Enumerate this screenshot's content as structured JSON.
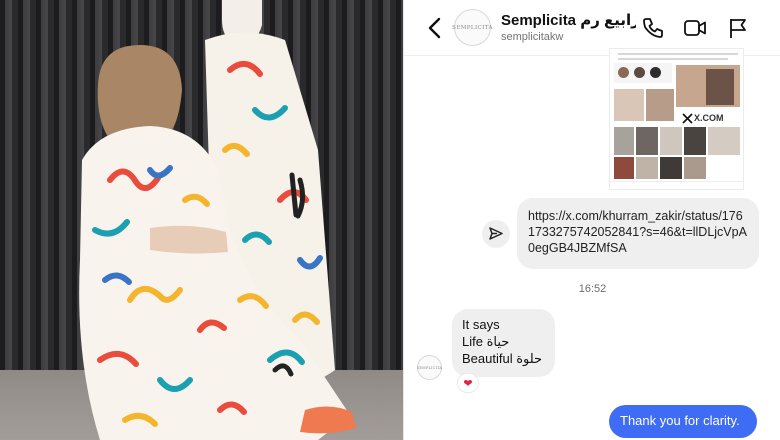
{
  "header": {
    "name": "Semplicita درابيع رم...",
    "handle": "semplicitakw",
    "avatar_text": "SEMPLICITA"
  },
  "shared_post": {
    "site_label": "X.COM"
  },
  "messages": {
    "link_text": "https://x.com/khurram_zakir/status/1761733275742052841?s=46&t=llDLjcVpA0egGB4JBZMfSA",
    "timestamp": "16:52",
    "received_lines": {
      "l1": "It says",
      "l2_en": "Life",
      "l2_ar": "حياة",
      "l3_en": "Beautiful",
      "l3_ar": "حلوة"
    },
    "reaction": "❤",
    "sent_text": "Thank you for clarity."
  },
  "colors": {
    "sent_bubble": "#3f6cf5",
    "received_bubble": "#efefef",
    "reaction_heart": "#e0263f"
  },
  "icons": [
    "back-chevron-icon",
    "phone-icon",
    "video-camera-icon",
    "flag-icon",
    "share-arrow-icon",
    "x-logo-icon"
  ]
}
